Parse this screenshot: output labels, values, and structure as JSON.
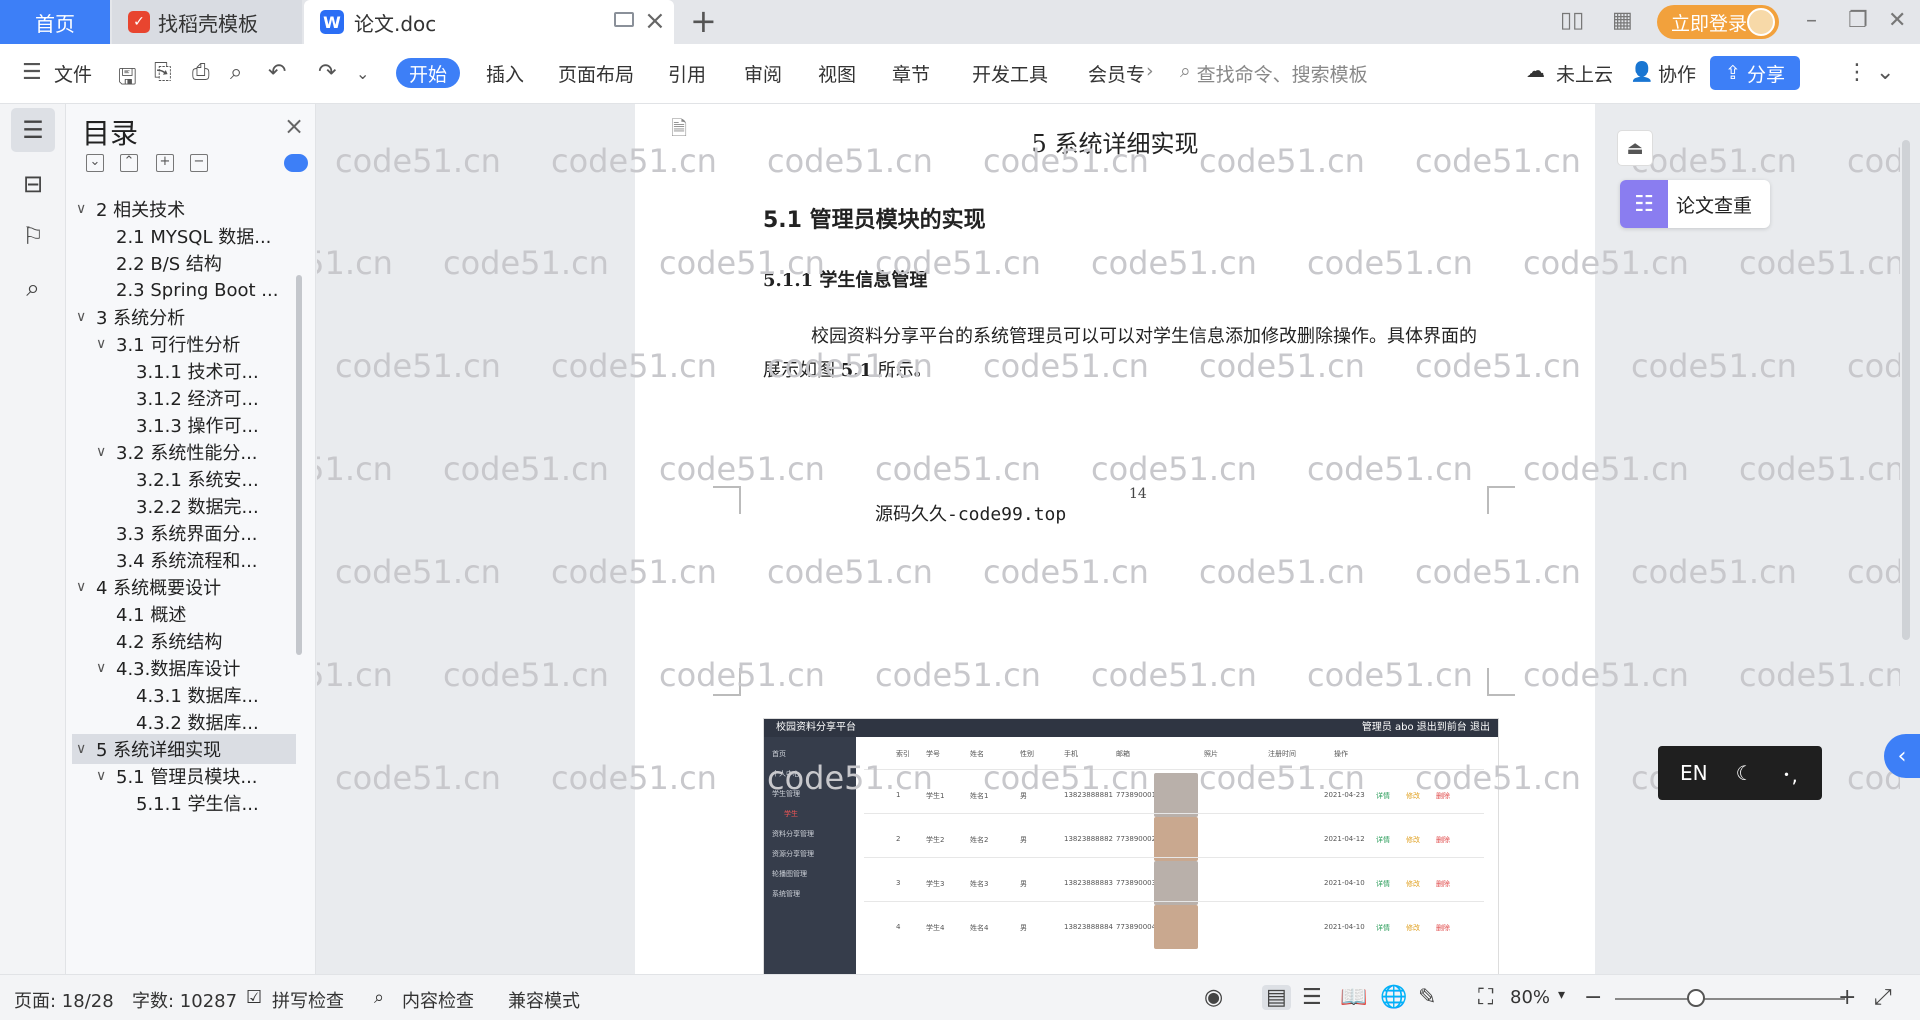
{
  "titlebar": {
    "tabs": [
      {
        "label": "首页"
      },
      {
        "label": "找稻壳模板"
      },
      {
        "label": "论文.doc"
      }
    ],
    "login_label": "立即登录"
  },
  "ribbon": {
    "file_label": "文件",
    "menus": [
      "开始",
      "插入",
      "页面布局",
      "引用",
      "审阅",
      "视图",
      "章节",
      "开发工具",
      "会员专"
    ],
    "search_placeholder": "查找命令、搜索模板",
    "cloud_label": "未上云",
    "collab_label": "协作",
    "share_label": "分享"
  },
  "toc": {
    "title": "目录",
    "items": [
      {
        "label": "2 相关技术",
        "level": 1,
        "expanded": true
      },
      {
        "label": "2.1 MYSQL 数据...",
        "level": 2
      },
      {
        "label": "2.2 B/S 结构",
        "level": 2
      },
      {
        "label": "2.3 Spring Boot ...",
        "level": 2
      },
      {
        "label": "3 系统分析",
        "level": 1,
        "expanded": true
      },
      {
        "label": "3.1 可行性分析",
        "level": 2,
        "expanded": true
      },
      {
        "label": "3.1.1 技术可...",
        "level": 3
      },
      {
        "label": "3.1.2 经济可...",
        "level": 3
      },
      {
        "label": "3.1.3 操作可...",
        "level": 3
      },
      {
        "label": "3.2 系统性能分...",
        "level": 2,
        "expanded": true
      },
      {
        "label": "3.2.1 系统安...",
        "level": 3
      },
      {
        "label": "3.2.2 数据完...",
        "level": 3
      },
      {
        "label": "3.3 系统界面分...",
        "level": 2
      },
      {
        "label": "3.4 系统流程和...",
        "level": 2
      },
      {
        "label": "4 系统概要设计",
        "level": 1,
        "expanded": true
      },
      {
        "label": "4.1 概述",
        "level": 2
      },
      {
        "label": "4.2 系统结构",
        "level": 2
      },
      {
        "label": "4.3.数据库设计",
        "level": 2,
        "expanded": true
      },
      {
        "label": "4.3.1 数据库...",
        "level": 3
      },
      {
        "label": "4.3.2 数据库...",
        "level": 3
      },
      {
        "label": "5 系统详细实现",
        "level": 1,
        "expanded": true,
        "selected": true
      },
      {
        "label": "5.1 管理员模块...",
        "level": 2,
        "expanded": true
      },
      {
        "label": "5.1.1 学生信...",
        "level": 3
      }
    ]
  },
  "document": {
    "watermark": "code51.cn",
    "heading1": "5 系统详细实现",
    "heading2": "5.1  管理员模块的实现",
    "heading3": "5.1.1  学生信息管理",
    "paragraph_pre": "校园资料分享平台的系统管理员可以可以对学生信息添加修改删除操作。具体界面的展示如图 ",
    "paragraph_ref": "5.1",
    "paragraph_post": " 所示。",
    "page_number": "14",
    "footer": "源码久久-code99.top",
    "figure": {
      "app_title": "校园资料分享平台",
      "top_right": "管理员 abo   退出到前台   退出",
      "sidebar": [
        "首页",
        "个人中心",
        "学生管理",
        "学生",
        "资料分享管理",
        "资源分享管理",
        "轮播图管理",
        "系统管理"
      ],
      "headers": [
        "索引",
        "学号",
        "姓名",
        "性别",
        "手机",
        "邮箱",
        "照片",
        "注册时间",
        "操作"
      ],
      "rows": [
        [
          "1",
          "学生1",
          "姓名1",
          "男",
          "13823888881",
          "773890001@qq.com",
          "2021-04-23"
        ],
        [
          "2",
          "学生2",
          "姓名2",
          "男",
          "13823888882",
          "773890002@qq.com",
          "2021-04-12"
        ],
        [
          "3",
          "学生3",
          "姓名3",
          "男",
          "13823888883",
          "773890003@qq.com",
          "2021-04-10"
        ],
        [
          "4",
          "学生4",
          "姓名4",
          "男",
          "13823888884",
          "773890004@qq.com",
          "2021-04-10"
        ]
      ],
      "actions": [
        "详情",
        "修改",
        "删除"
      ]
    }
  },
  "right_tools": {
    "paper_check": "论文查重",
    "ime": "EN"
  },
  "statusbar": {
    "page": "页面: 18/28",
    "words": "字数: 10287",
    "spell": "拼写检查",
    "content_check": "内容检查",
    "compat": "兼容模式",
    "zoom": "80%"
  },
  "colors": {
    "accent": "#3d7ff7",
    "login": "#f2a13c",
    "paper_check": "#8a7df0"
  }
}
